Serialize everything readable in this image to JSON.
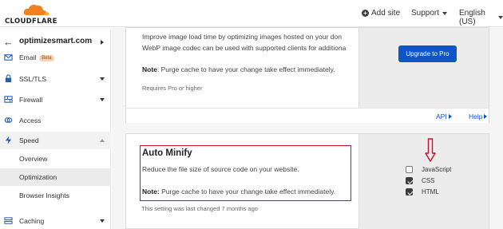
{
  "header": {
    "logo_text": "CLOUDFLARE",
    "add_site": "Add site",
    "support": "Support",
    "language": "English (US)"
  },
  "sidebar": {
    "site": "optimizesmart.com",
    "items": [
      {
        "label": "Email",
        "badge": "Beta"
      },
      {
        "label": "SSL/TLS"
      },
      {
        "label": "Firewall"
      },
      {
        "label": "Access"
      },
      {
        "label": "Speed"
      },
      {
        "label": "Overview"
      },
      {
        "label": "Optimization"
      },
      {
        "label": "Browser Insights"
      },
      {
        "label": "Caching"
      }
    ]
  },
  "polish_card": {
    "desc_line1": "Improve image load time by optimizing images hosted on your don",
    "desc_line2": "WebP image codec can be used with supported clients for additiona",
    "note_label": "Note",
    "note_text": ": Purge cache to have your change take effect immediately.",
    "requires": "Requires Pro or higher",
    "upgrade_button": "Upgrade to Pro",
    "api_link": "API",
    "help_link": "Help"
  },
  "auto_minify": {
    "title": "Auto Minify",
    "description": "Reduce the file size of source code on your website.",
    "note_label": "Note:",
    "note_text": " Purge cache to have your change take effect immediately.",
    "last_changed": "This setting was last changed 7 months ago",
    "options": [
      {
        "label": "JavaScript",
        "checked": false
      },
      {
        "label": "CSS",
        "checked": true
      },
      {
        "label": "HTML",
        "checked": true
      }
    ]
  },
  "colors": {
    "accent": "#0f55c5",
    "logo_orange": "#f38020",
    "highlight_red": "#c8102e"
  }
}
